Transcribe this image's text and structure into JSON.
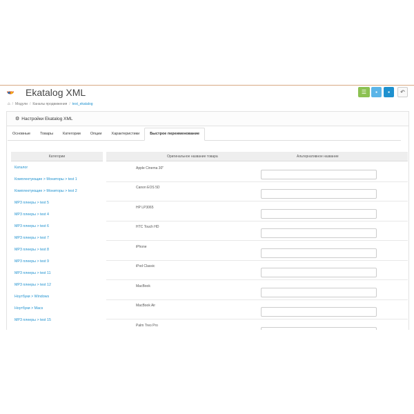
{
  "header": {
    "title": "Ekatalog XML",
    "buttons": [
      {
        "name": "list-button",
        "icon": "list-icon",
        "color": "#8cc152"
      },
      {
        "name": "save-button",
        "icon": "save-icon",
        "color": "#5bb5e8"
      },
      {
        "name": "save-stay-button",
        "icon": "save-icon",
        "color": "#1e91cf"
      },
      {
        "name": "back-button",
        "icon": "reply-icon",
        "color": "#f8f8f8"
      }
    ]
  },
  "breadcrumb": {
    "items": [
      "Модули",
      "Каналы продвижения",
      "test_ekatalog"
    ]
  },
  "panel": {
    "title": "Настройки Ekatalog XML"
  },
  "tabs": [
    "Основные",
    "Товары",
    "Категории",
    "Опции",
    "Характеристики",
    "Быстрое переименование"
  ],
  "categories": {
    "header": "Категории",
    "items": [
      "Каталог",
      "Комплектующие  >  Мониторы  >  test 1",
      "Комплектующие  >  Мониторы  >  test 2",
      "MP3 плееры  >  test 5",
      "MP3 плееры  >  test 4",
      "MP3 плееры  >  test 6",
      "MP3 плееры  >  test 7",
      "MP3 плееры  >  test 8",
      "MP3 плееры  >  test 9",
      "MP3 плееры  >  test 11",
      "MP3 плееры  >  test 12",
      "Ноутбуки  >  Windows",
      "Ноутбуки  >  Macs",
      "MP3 плееры  >  test 15"
    ]
  },
  "products": {
    "col_original": "Оригинальное название товара",
    "col_alt": "Альтернативное название",
    "rows": [
      {
        "name": "Apple Cinema 30\"",
        "alt": ""
      },
      {
        "name": "Canon EOS 5D",
        "alt": ""
      },
      {
        "name": "HP LP3065",
        "alt": ""
      },
      {
        "name": "HTC Touch HD",
        "alt": ""
      },
      {
        "name": "iPhone",
        "alt": ""
      },
      {
        "name": "iPod Classic",
        "alt": ""
      },
      {
        "name": "MacBook",
        "alt": ""
      },
      {
        "name": "MacBook Air",
        "alt": ""
      },
      {
        "name": "Palm Treo Pro",
        "alt": ""
      }
    ]
  },
  "colors": {
    "accent": "#1e91cf",
    "success": "#8cc152"
  }
}
